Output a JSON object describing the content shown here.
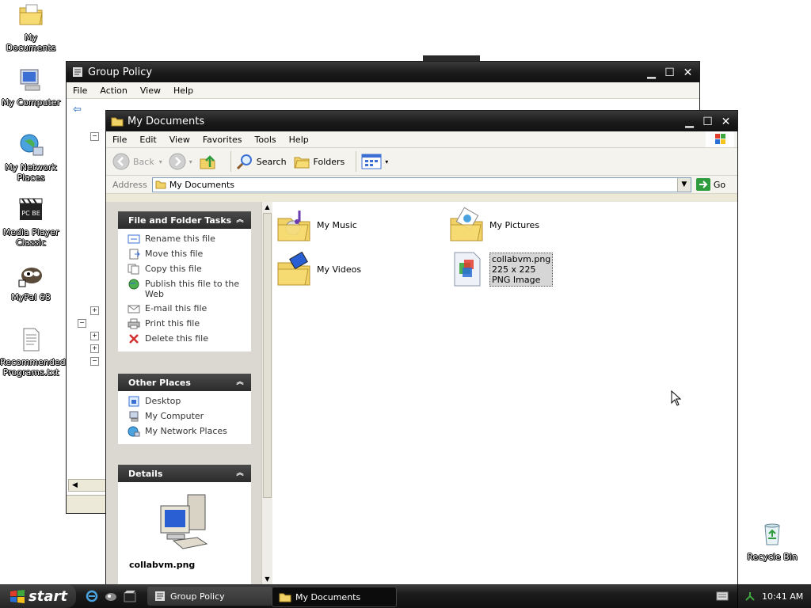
{
  "desktop": {
    "icons": [
      {
        "label": "My Documents",
        "icon": "my-documents-icon"
      },
      {
        "label": "My Computer",
        "icon": "my-computer-icon"
      },
      {
        "label": "My Network Places",
        "icon": "network-places-icon"
      },
      {
        "label": "Media Player Classic",
        "icon": "media-player-icon"
      },
      {
        "label": "MyPal 68",
        "icon": "mypal-icon"
      },
      {
        "label": "Recommended Programs.txt",
        "icon": "text-file-icon"
      },
      {
        "label": "Recycle Bin",
        "icon": "recycle-bin-icon"
      }
    ]
  },
  "gp_window": {
    "title": "Group Policy",
    "menu": [
      "File",
      "Action",
      "View",
      "Help"
    ]
  },
  "mydocs_window": {
    "title": "My Documents",
    "menu": [
      "File",
      "Edit",
      "View",
      "Favorites",
      "Tools",
      "Help"
    ],
    "toolbar": {
      "back": "Back",
      "search": "Search",
      "folders": "Folders"
    },
    "address": {
      "label": "Address",
      "value": "My Documents",
      "go": "Go"
    },
    "tasks_panel": {
      "title": "File and Folder Tasks",
      "items": [
        "Rename this file",
        "Move this file",
        "Copy this file",
        "Publish this file to the Web",
        "E-mail this file",
        "Print this file",
        "Delete this file"
      ]
    },
    "places_panel": {
      "title": "Other Places",
      "items": [
        "Desktop",
        "My Computer",
        "My Network Places"
      ]
    },
    "details_panel": {
      "title": "Details",
      "filename": "collabvm.png"
    },
    "files": [
      {
        "name": "My Music",
        "icon": "music-folder-icon"
      },
      {
        "name": "My Pictures",
        "icon": "pictures-folder-icon"
      },
      {
        "name": "My Videos",
        "icon": "videos-folder-icon"
      },
      {
        "name": "collabvm.png",
        "dims": "225 x 225",
        "type": "PNG Image",
        "icon": "png-file-icon"
      }
    ]
  },
  "taskbar": {
    "start": "start",
    "buttons": [
      "Group Policy",
      "My Documents"
    ],
    "clock": "10:41 AM"
  }
}
